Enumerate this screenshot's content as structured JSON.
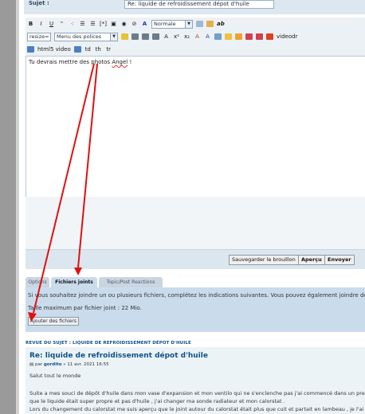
{
  "subject": {
    "label": "Sujet :",
    "value": "Re: liquide de refroidissement dépot d'huile"
  },
  "toolbar": {
    "row1": [
      "B",
      "I",
      "U",
      "\"",
      "⁖",
      "☰",
      "☰",
      "[*]",
      "▣",
      "◉",
      "⊘",
      "A"
    ],
    "size_select": "Normale",
    "row1_end": "ab",
    "resize_label": "resize=",
    "font_select": "Menu des polices",
    "row2_end": "videodr",
    "html5_video": "html5 video",
    "td": "td",
    "th": "th",
    "tr": "tr"
  },
  "editor": {
    "text_before": "Tu devrais mettre des photos ",
    "text_underlined": "Angel",
    "text_after": " !"
  },
  "buttons": {
    "save_draft": "Sauvegarder le brouillon",
    "preview": "Aperçu",
    "submit": "Envoyer"
  },
  "tabs": [
    "Options",
    "Fichiers joints",
    "Topic/Post Reactions"
  ],
  "attachments": {
    "intro": "Si vous souhaitez joindre un ou plusieurs fichiers, complétez les indications suivantes. Vous pouvez également joindre de",
    "max_size": "Taille maximum par fichier joint : 22 Mio.",
    "add_button": "Ajouter des fichiers"
  },
  "review": {
    "heading": "REVUE DU SUJET : LIQUIDE DE REFROIDISSEMENT DÉPOT D'HUILE",
    "post_title": "Re: liquide de refroidissement dépot d'huile",
    "meta_by": "par",
    "meta_author": "gordito",
    "meta_date": "» 11 avr. 2021 16:55",
    "greeting": "Salut tout le monde",
    "line1": "Suite a mes souci de dépôt d'huile dans mon vase d'expansion et mon ventilo qui ne s'enclenche pas j'ai commencé dans un premie",
    "line2": "que le liquide était super propre et pas d'huile , j'ai changer ma sonde radiateur et mon calorstat .",
    "line3": "Lors du changement du calorstat me suis aperçu que le joint autour du calorstat était plus que cuit et partait en lambeau , je l'ai c"
  },
  "colors": {
    "arrow": "#e01010",
    "link": "#105289",
    "panel": "#cadcec"
  }
}
